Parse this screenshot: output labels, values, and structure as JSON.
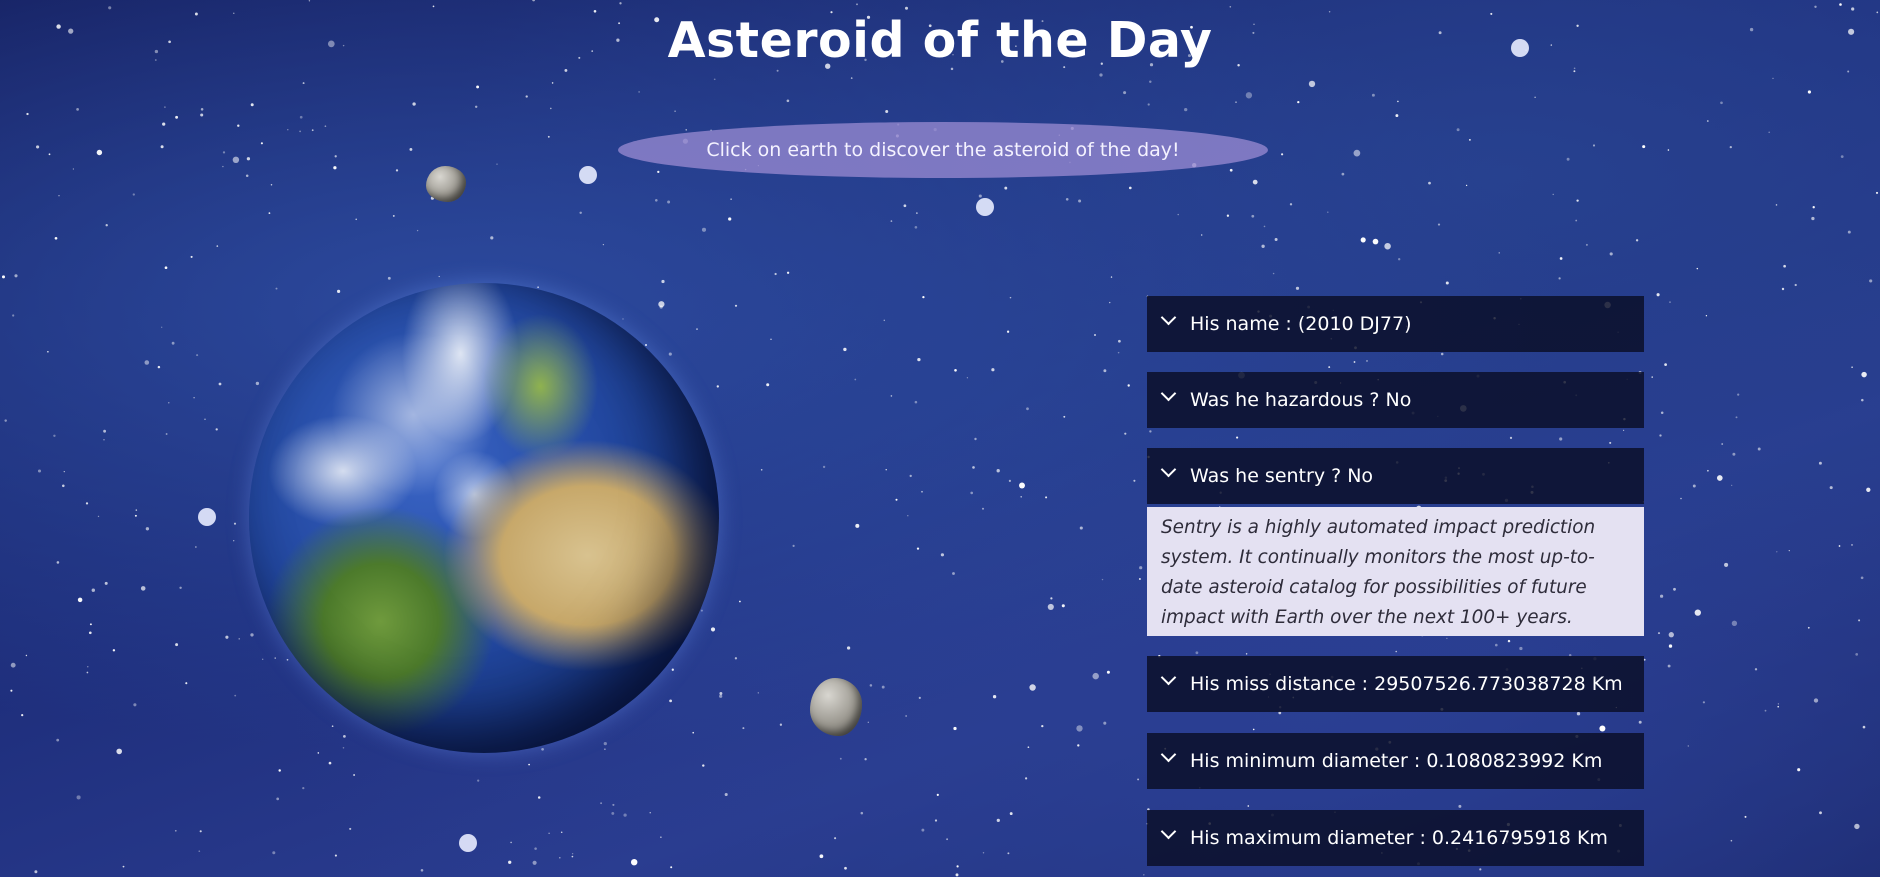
{
  "page": {
    "title": "Asteroid of the Day",
    "cta_label": "Click on earth to discover the asteroid of the day!"
  },
  "accordion": [
    {
      "label": "His name : (2010 DJ77)",
      "expanded": false
    },
    {
      "label": "Was he hazardous ? No",
      "expanded": false
    },
    {
      "label": "Was he sentry ? No",
      "expanded": true,
      "body": "Sentry is a highly automated impact prediction system. It continually monitors the most up-to-date asteroid catalog for possibilities of future impact with Earth over the next 100+ years."
    },
    {
      "label": "His miss distance : 29507526.773038728 Km",
      "expanded": false
    },
    {
      "label": "His minimum diameter : 0.1080823992 Km",
      "expanded": false
    },
    {
      "label": "His maximum diameter : 0.2416795918 Km",
      "expanded": false
    }
  ],
  "colors": {
    "background": "#1f2f7d",
    "cta_pill": "#9185cd",
    "accordion_header": "#0a0e26",
    "accordion_body": "#e4e1f2"
  },
  "icons": [
    "chevron-down-icon",
    "earth-image",
    "asteroid-image"
  ]
}
